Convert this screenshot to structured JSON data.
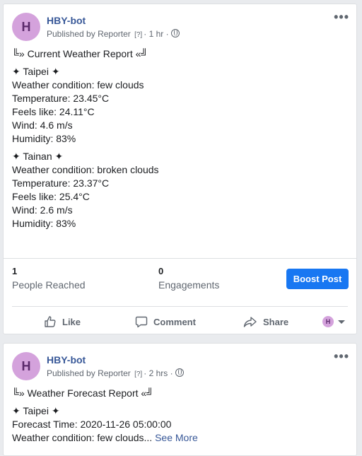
{
  "posts": [
    {
      "author": "HBY-bot",
      "avatar_letter": "H",
      "published_by": "Published by",
      "reporter": "Reporter",
      "help": "[?]",
      "separator": "·",
      "time": "1 hr",
      "more": "•••",
      "lines": [
        [
          "╚» Current Weather Report «╝"
        ],
        [
          "✦ Taipei ✦",
          "Weather condition: few clouds",
          "Temperature: 23.45°C",
          "Feels like: 24.11°C",
          "Wind: 4.6 m/s",
          "Humidity: 83%"
        ],
        [
          "✦ Tainan ✦",
          "Weather condition: broken clouds",
          "Temperature: 23.37°C",
          "Feels like: 25.4°C",
          "Wind: 2.6 m/s",
          "Humidity: 83%"
        ]
      ],
      "stats": {
        "reached_value": "1",
        "reached_label": "People Reached",
        "engagements_value": "0",
        "engagements_label": "Engagements",
        "boost_label": "Boost Post"
      },
      "actions": {
        "like": "Like",
        "comment": "Comment",
        "share": "Share",
        "avatar_letter": "H"
      }
    },
    {
      "author": "HBY-bot",
      "avatar_letter": "H",
      "published_by": "Published by",
      "reporter": "Reporter",
      "help": "[?]",
      "separator": "·",
      "time": "2 hrs",
      "more": "•••",
      "title": "╚» Weather Forecast Report «╝",
      "city": "✦ Taipei ✦",
      "forecast_time": "Forecast Time: 2020-11-26 05:00:00",
      "condition_truncated": "Weather condition: few clouds...",
      "see_more": "See More"
    }
  ],
  "colors": {
    "accent": "#1877f2",
    "link": "#385898",
    "avatar_bg": "#d4a2dc",
    "page_bg": "#e9ebee"
  }
}
